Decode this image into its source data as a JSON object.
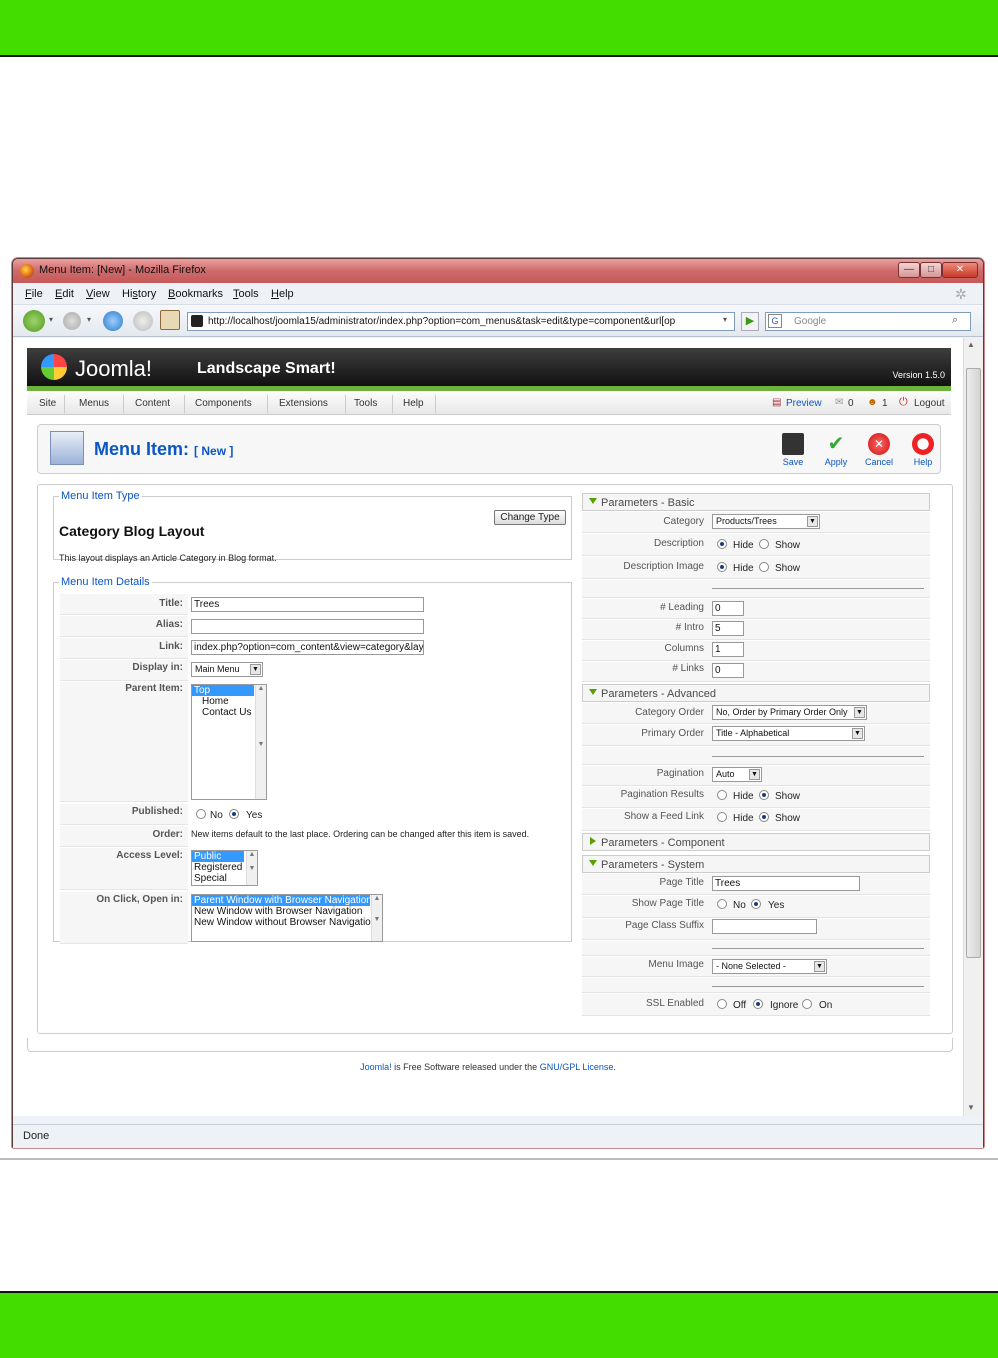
{
  "browser": {
    "title": "Menu Item: [New] - Mozilla Firefox",
    "menu": [
      "File",
      "Edit",
      "View",
      "History",
      "Bookmarks",
      "Tools",
      "Help"
    ],
    "menu_underline": [
      "F",
      "E",
      "V",
      "s",
      "B",
      "T",
      "H"
    ],
    "url": "http://localhost/joomla15/administrator/index.php?option=com_menus&task=edit&type=component&url[op",
    "search_placeholder": "Google",
    "status": "Done"
  },
  "joomla": {
    "logo": "Joomla!",
    "site_name": "Landscape Smart!",
    "version": "Version 1.5.0",
    "menu": [
      "Site",
      "Menus",
      "Content",
      "Components",
      "Extensions",
      "Tools",
      "Help"
    ],
    "right": {
      "preview": "Preview",
      "count1": "0",
      "count2": "1",
      "logout": "Logout"
    }
  },
  "toolbar": {
    "title": "Menu Item:",
    "title_sub": "[ New ]",
    "save": "Save",
    "apply": "Apply",
    "cancel": "Cancel",
    "help": "Help"
  },
  "item_type": {
    "legend": "Menu Item Type",
    "name": "Category Blog Layout",
    "desc": "This layout displays an Article Category in Blog format.",
    "change_btn": "Change Type"
  },
  "details": {
    "legend": "Menu Item Details",
    "title_label": "Title:",
    "title_value": "Trees",
    "alias_label": "Alias:",
    "alias_value": "",
    "link_label": "Link:",
    "link_value": "index.php?option=com_content&view=category&layout=b",
    "display_label": "Display in:",
    "display_value": "Main Menu",
    "parent_label": "Parent Item:",
    "parent_items": [
      "Top",
      "Home",
      "Contact Us"
    ],
    "published_label": "Published:",
    "no": "No",
    "yes": "Yes",
    "order_label": "Order:",
    "order_text": "New items default to the last place. Ordering can be changed after this item is saved.",
    "access_label": "Access Level:",
    "access_items": [
      "Public",
      "Registered",
      "Special"
    ],
    "onclick_label": "On Click, Open in:",
    "onclick_items": [
      "Parent Window with Browser Navigation",
      "New Window with Browser Navigation",
      "New Window without Browser Navigation"
    ]
  },
  "params": {
    "basic": {
      "head": "Parameters - Basic",
      "category_label": "Category",
      "category_value": "Products/Trees",
      "description_label": "Description",
      "description_image_label": "Description Image",
      "hide": "Hide",
      "show": "Show",
      "leading_label": "# Leading",
      "leading_value": "0",
      "intro_label": "# Intro",
      "intro_value": "5",
      "columns_label": "Columns",
      "columns_value": "1",
      "links_label": "# Links",
      "links_value": "0"
    },
    "advanced": {
      "head": "Parameters - Advanced",
      "cat_order_label": "Category Order",
      "cat_order_value": "No, Order by Primary Order Only",
      "primary_order_label": "Primary Order",
      "primary_order_value": "Title - Alphabetical",
      "pagination_label": "Pagination",
      "pagination_value": "Auto",
      "pag_results_label": "Pagination Results",
      "feed_label": "Show a Feed Link",
      "hide": "Hide",
      "show": "Show"
    },
    "component": {
      "head": "Parameters - Component"
    },
    "system": {
      "head": "Parameters - System",
      "page_title_label": "Page Title",
      "page_title_value": "Trees",
      "show_title_label": "Show Page Title",
      "no": "No",
      "yes": "Yes",
      "class_suffix_label": "Page Class Suffix",
      "menu_image_label": "Menu Image",
      "menu_image_value": "- None Selected -",
      "ssl_label": "SSL Enabled",
      "off": "Off",
      "ignore": "Ignore",
      "on": "On"
    }
  },
  "footer": {
    "link1": "Joomla!",
    "text": " is Free Software released under the ",
    "link2": "GNU/GPL License",
    "end": "."
  }
}
